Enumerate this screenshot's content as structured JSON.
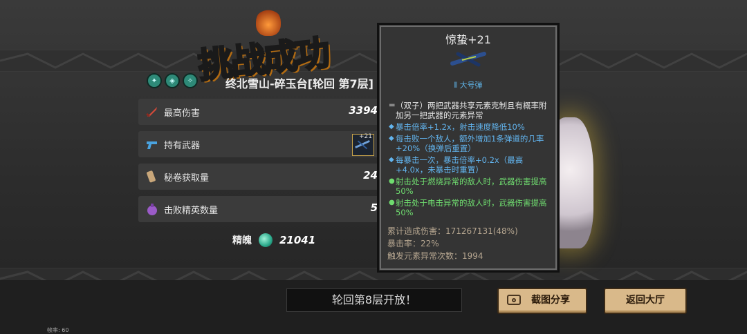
{
  "header": {
    "title": "挑战成功",
    "stage": "终北雪山-碎玉台[轮回  第7层]"
  },
  "stats": {
    "max_damage_label": "最高伤害",
    "max_damage_value": "3394",
    "weapons_label": "持有武器",
    "weapon_plus": "+21",
    "scrolls_label": "秘卷获取量",
    "scrolls_value": "24",
    "elites_label": "击败精英数量",
    "elites_value": "5"
  },
  "essence": {
    "label": "精魄",
    "value": "21041"
  },
  "tooltip": {
    "name": "惊蛰+21",
    "ammo": "大号弹",
    "lines": [
      {
        "bullet": "▬",
        "text": "（双子）两把武器共享元素克制且有概率附加另一把武器的元素异常",
        "color": "white"
      },
      {
        "bullet": "◆",
        "text": "暴击倍率+1.2x，射击速度降低10%",
        "color": "blue"
      },
      {
        "bullet": "◆",
        "text": "每击败一个敌人，额外增加1条弹道的几率+20%（换弹后重置）",
        "color": "blue"
      },
      {
        "bullet": "◆",
        "text": "每暴击一次，暴击倍率+0.2x（最高+4.0x，未暴击时重置）",
        "color": "blue"
      },
      {
        "bullet": "●",
        "text": "射击处于燃烧异常的敌人时，武器伤害提高50%",
        "color": "green"
      },
      {
        "bullet": "●",
        "text": "射击处于电击异常的敌人时，武器伤害提高50%",
        "color": "green"
      }
    ],
    "cumulative_damage": "累计造成伤害：171267131(48%)",
    "crit_rate": "暴击率：22%",
    "element_triggers": "触发元素异常次数：1994"
  },
  "footer": {
    "notice": "轮回第8层开放！",
    "share_button": "截图分享",
    "lobby_button": "返回大厅",
    "fps": "帧率: 60"
  },
  "colors": {
    "accent_gold": "#f2c530",
    "tooltip_blue": "#62b4ee",
    "tooltip_green": "#6fdc6f",
    "button_tan": "#d9b98a"
  },
  "icons": {
    "max_damage": "sword-icon",
    "weapons": "gun-icon",
    "scrolls": "scroll-icon",
    "elites": "potion-icon",
    "essence": "gem-icon",
    "share": "camera-icon"
  }
}
